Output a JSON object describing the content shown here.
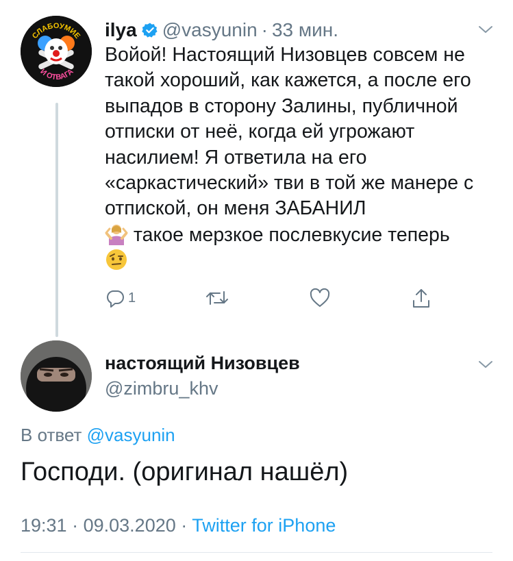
{
  "tweet1": {
    "avatar_text_top": "СЛАБОУМИЕ",
    "avatar_text_bottom": "И ОТВАГА",
    "name": "ilya",
    "handle": "@vasyunin",
    "separator": "·",
    "time": "33 мин.",
    "text_main": "Войой! Настоящий Низовцев  совсем не такой хороший, как кажется, а после его выпадов в сторону Залины, публичной отписки от неё, когда ей угрожают насилием! Я ответила на его «саркастический» тви в той же манере с отпиской, он меня ЗАБАНИЛ",
    "text_after_emoji": " такое мерзкое послевкусие теперь",
    "emoji1": "woman-shrugging",
    "emoji2": "face-with-raised-eyebrow",
    "reply_count": "1"
  },
  "tweet2": {
    "name": "настоящий Низовцев",
    "handle": "@zimbru_khv",
    "reply_prefix": "В ответ",
    "reply_handle": "@vasyunin",
    "text": "Господи. (оригинал нашёл)",
    "time": "19:31",
    "separator": "·",
    "date": "09.03.2020",
    "separator2": "·",
    "client": "Twitter for iPhone"
  },
  "colors": {
    "primary_text": "#14171a",
    "secondary_text": "#657786",
    "link": "#1da1f2",
    "thread_line": "#cfd9de",
    "divider": "#e1e8ed"
  },
  "icons": [
    "verified-badge-icon",
    "chevron-down-icon",
    "reply-icon",
    "retweet-icon",
    "like-icon",
    "share-icon"
  ]
}
